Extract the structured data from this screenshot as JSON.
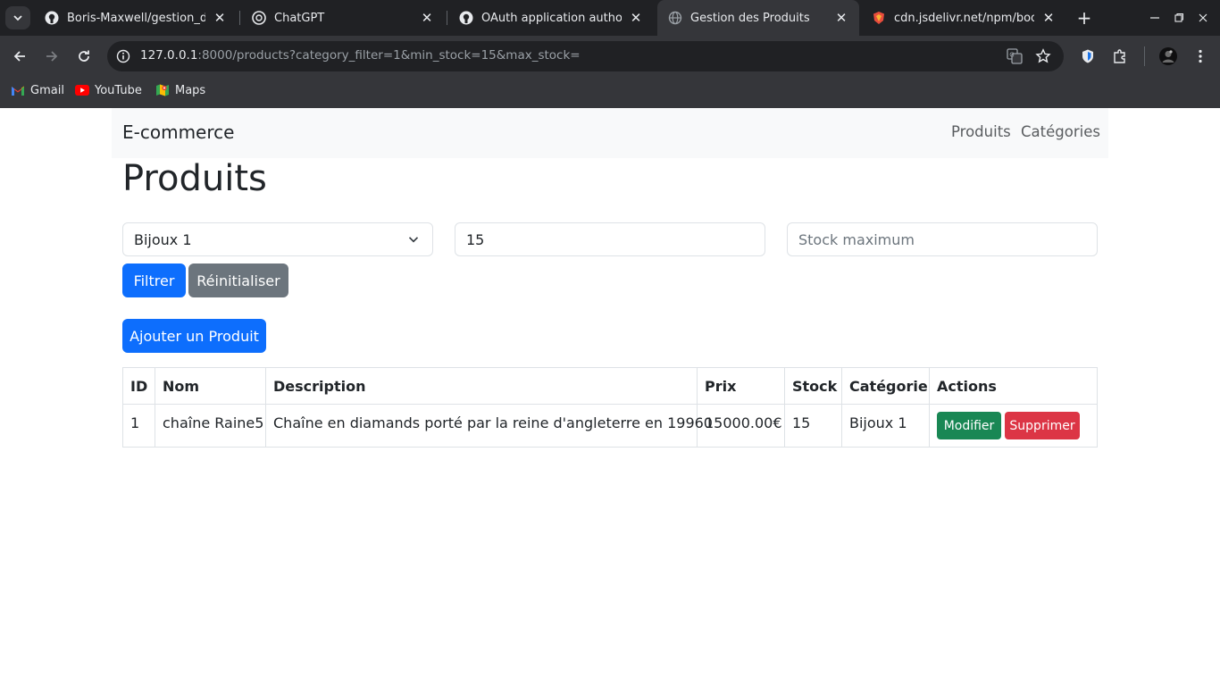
{
  "browser": {
    "tabs": [
      {
        "title": "Boris-Maxwell/gestion_de_",
        "icon": "github-icon"
      },
      {
        "title": "ChatGPT",
        "icon": "chatgpt-icon"
      },
      {
        "title": "OAuth application authoriz",
        "icon": "github-icon"
      },
      {
        "title": "Gestion des Produits",
        "icon": "globe-icon",
        "active": true
      },
      {
        "title": "cdn.jsdelivr.net/npm/boots",
        "icon": "jsdelivr-icon"
      }
    ],
    "url_host": "127.0.0.1",
    "url_path": ":8000/products?category_filter=1&min_stock=15&max_stock=",
    "bookmarks": [
      "Gmail",
      "YouTube",
      "Maps"
    ]
  },
  "navbar": {
    "brand": "E-commerce",
    "links": [
      "Produits",
      "Catégories"
    ]
  },
  "main": {
    "title": "Produits",
    "filters": {
      "category_value": "Bijoux 1",
      "min_stock_value": "15",
      "max_stock_placeholder": "Stock maximum"
    },
    "filter_button": "Filtrer",
    "reset_button": "Réinitialiser",
    "add_button": "Ajouter un Produit"
  },
  "table": {
    "headers": [
      "ID",
      "Nom",
      "Description",
      "Prix",
      "Stock",
      "Catégorie",
      "Actions"
    ],
    "rows": [
      {
        "id": "1",
        "nom": "chaîne Raine5",
        "description": "Chaîne en diamands porté par la reine d'angleterre en 19960",
        "prix": "15000.00€",
        "stock": "15",
        "categorie": "Bijoux 1",
        "edit_label": "Modifier",
        "delete_label": "Supprimer"
      }
    ]
  },
  "colors": {
    "primary": "#0d6efd",
    "secondary": "#6c757d",
    "success": "#198754",
    "danger": "#dc3545",
    "chrome_dark": "#202124",
    "chrome_toolbar": "#35363a"
  }
}
